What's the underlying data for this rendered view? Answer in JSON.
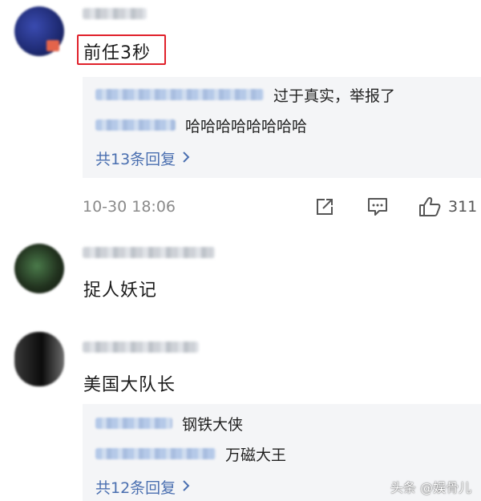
{
  "comments": [
    {
      "text": "前任3秒",
      "replies": [
        {
          "text": "过于真实，举报了"
        },
        {
          "text": "哈哈哈哈哈哈哈哈"
        }
      ],
      "more_replies": "共13条回复",
      "timestamp": "10-30 18:06",
      "likes": "311"
    },
    {
      "text": "捉人妖记"
    },
    {
      "text": "美国大队长",
      "replies": [
        {
          "text": "钢铁大侠"
        },
        {
          "text": "万磁大王"
        }
      ],
      "more_replies": "共12条回复"
    }
  ],
  "icons": {
    "share": "share-icon",
    "reply": "comment-icon",
    "like": "thumbs-up-icon",
    "chevron": "chevron-right-icon"
  },
  "colors": {
    "highlight_box": "#e0212b",
    "link": "#4a6fb0",
    "reply_background": "#f4f5f7"
  },
  "watermark": "头条 @娱骨儿"
}
